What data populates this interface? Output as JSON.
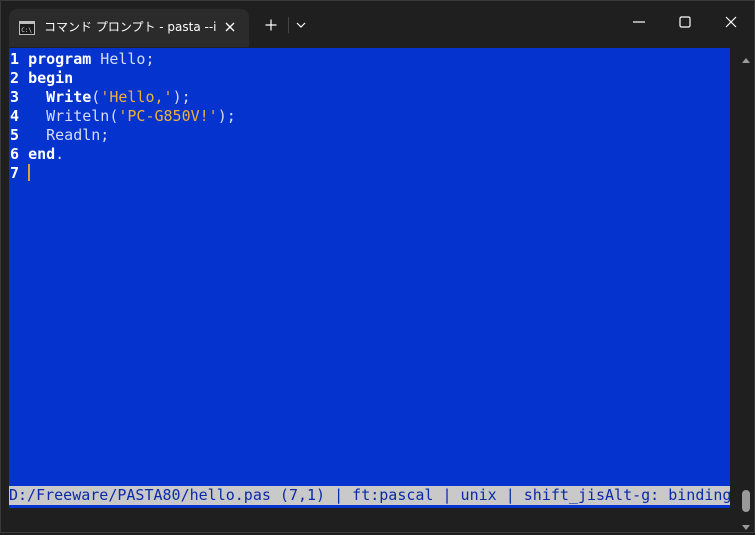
{
  "window": {
    "tab_title": "コマンド プロンプト - pasta  --ide -",
    "tab_icon": "command-prompt-icon",
    "tab_icon_label": "C:\\"
  },
  "editor": {
    "lines": [
      {
        "num": "1",
        "tokens": [
          {
            "t": "kw",
            "v": "program"
          },
          {
            "t": "id",
            "v": " Hello;"
          }
        ]
      },
      {
        "num": "2",
        "tokens": [
          {
            "t": "kw",
            "v": "begin"
          }
        ]
      },
      {
        "num": "3",
        "tokens": [
          {
            "t": "id",
            "v": "  "
          },
          {
            "t": "kw",
            "v": "Write"
          },
          {
            "t": "id",
            "v": "("
          },
          {
            "t": "str",
            "v": "'Hello,'"
          },
          {
            "t": "id",
            "v": ");"
          }
        ]
      },
      {
        "num": "4",
        "tokens": [
          {
            "t": "id",
            "v": "  Writeln("
          },
          {
            "t": "str",
            "v": "'PC-G850V!'"
          },
          {
            "t": "id",
            "v": ");"
          }
        ]
      },
      {
        "num": "5",
        "tokens": [
          {
            "t": "id",
            "v": "  Readln;"
          }
        ]
      },
      {
        "num": "6",
        "tokens": [
          {
            "t": "kw",
            "v": "end"
          },
          {
            "t": "id",
            "v": "."
          }
        ]
      },
      {
        "num": "7",
        "tokens": [],
        "cursor": true
      }
    ],
    "status": "D:/Freeware/PASTA80/hello.pas (7,1) | ft:pascal | unix | shift_jisAlt-g: binding"
  },
  "colors": {
    "background": "#0433ce",
    "keyword": "#ffffff",
    "identifier": "#d6dcf5",
    "string": "#f0b13a",
    "statusbar_bg": "#c9c9c9",
    "statusbar_fg": "#0a2aa8"
  }
}
